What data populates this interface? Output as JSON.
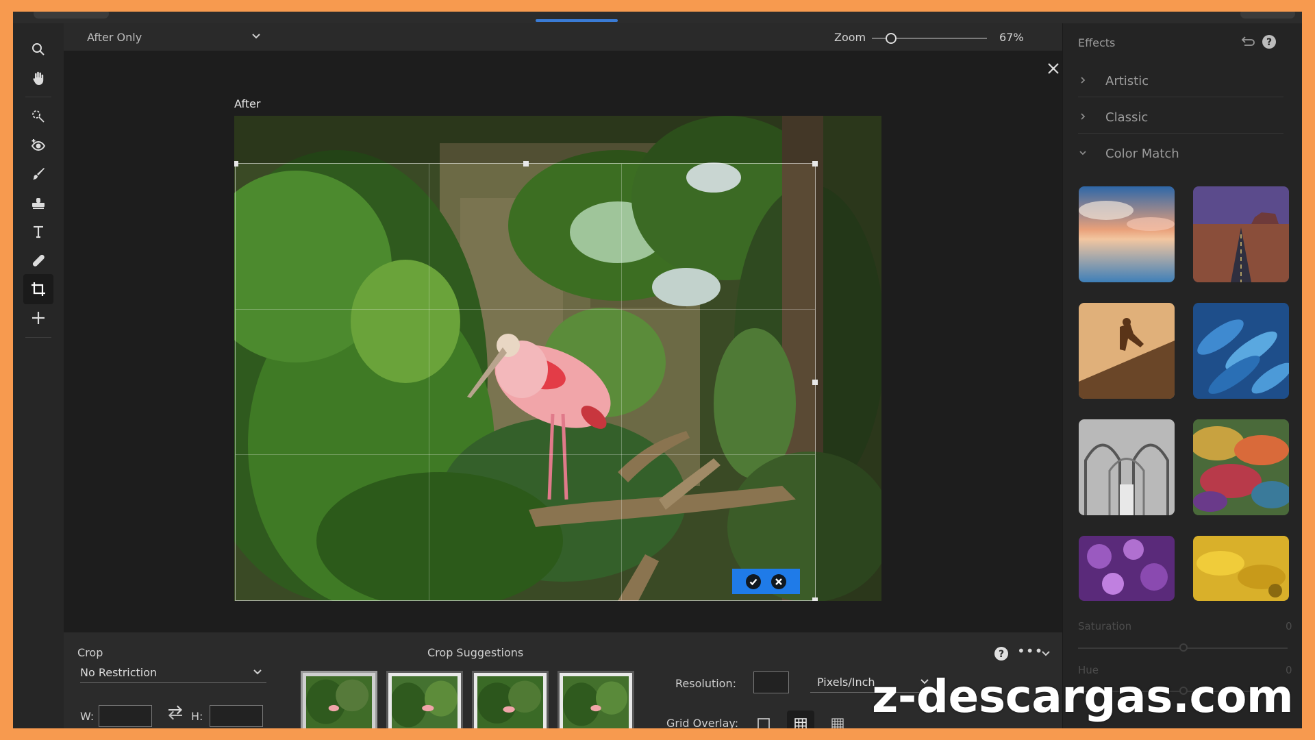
{
  "view": {
    "mode": "After Only"
  },
  "zoom": {
    "label": "Zoom",
    "value": "67%",
    "level": 0.12
  },
  "canvas": {
    "after_label": "After"
  },
  "crop_panel": {
    "title": "Crop",
    "ratio": "No Restriction",
    "width_label": "W:",
    "height_label": "H:",
    "width_value": "",
    "height_value": "",
    "suggestions_title": "Crop Suggestions",
    "resolution_label": "Resolution:",
    "resolution_value": "",
    "resolution_unit": "Pixels/Inch",
    "grid_overlay_label": "Grid Overlay:",
    "grid_overlay_selected": "grid"
  },
  "effects": {
    "title": "Effects",
    "categories": [
      {
        "label": "Artistic",
        "expanded": false
      },
      {
        "label": "Classic",
        "expanded": false
      },
      {
        "label": "Color Match",
        "expanded": true
      }
    ],
    "presets": [
      "sunset-lake",
      "desert-road",
      "skateboarder",
      "blue-feathers",
      "cathedral-arches",
      "colorful-paint",
      "purple-flowers",
      "yellow-flower"
    ],
    "sliders": [
      {
        "label": "Saturation",
        "value": "0"
      },
      {
        "label": "Hue",
        "value": "0"
      }
    ]
  },
  "tools": [
    "zoom",
    "hand",
    "quick-selection",
    "eye",
    "brush",
    "stamp",
    "text",
    "spot-healing",
    "crop",
    "move"
  ],
  "colors": {
    "accent": "#1f7be8",
    "frame": "#f79a4f",
    "panel": "#2b2b2b"
  },
  "watermark": "z-descargas.com"
}
